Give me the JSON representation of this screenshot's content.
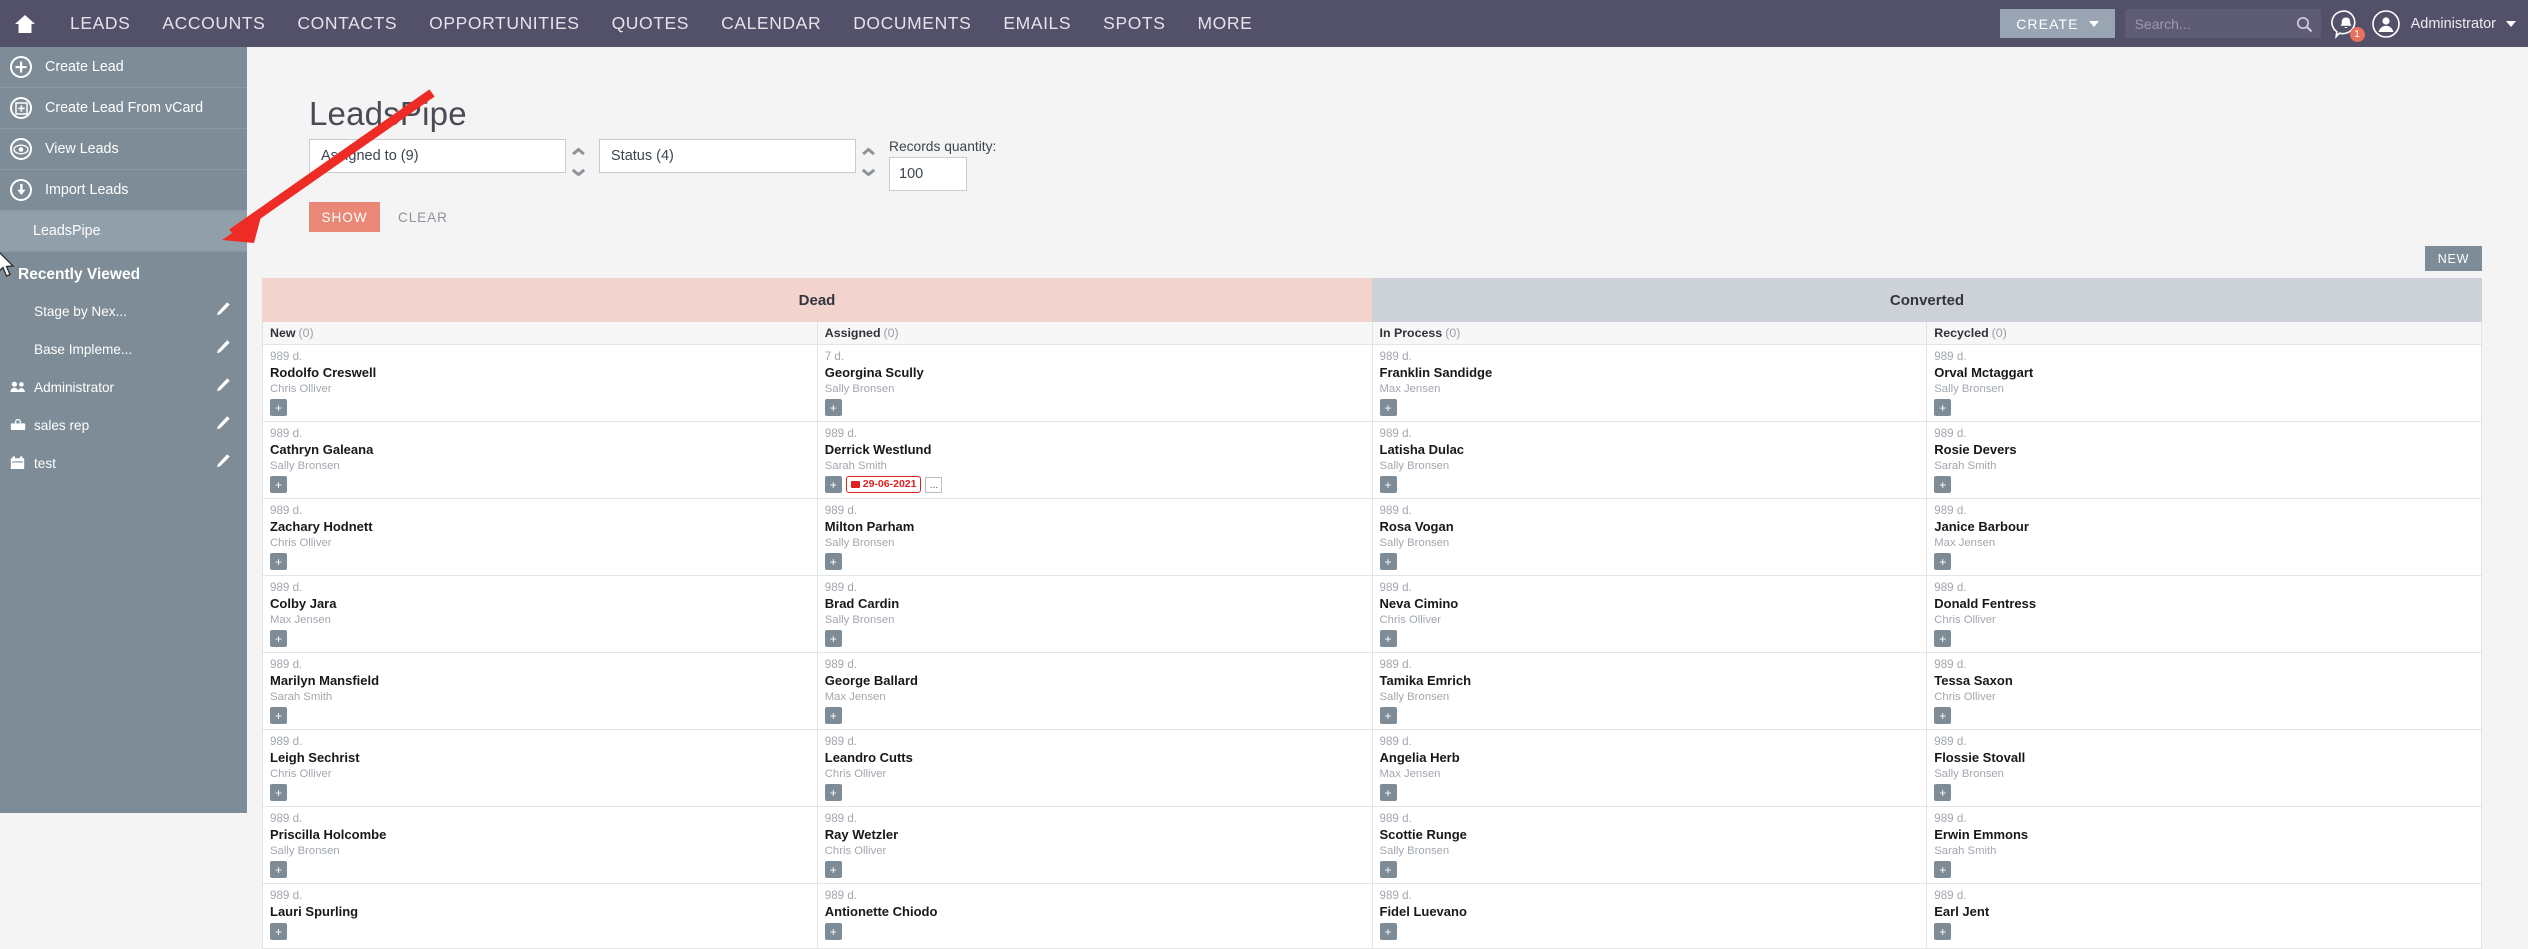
{
  "topnav": {
    "home_icon": "home-icon",
    "links": [
      "LEADS",
      "ACCOUNTS",
      "CONTACTS",
      "OPPORTUNITIES",
      "QUOTES",
      "CALENDAR",
      "DOCUMENTS",
      "EMAILS",
      "SPOTS",
      "MORE"
    ],
    "create_label": "CREATE",
    "search_placeholder": "Search...",
    "search_value": "",
    "notification_count": "1",
    "user_label": "Administrator",
    "bg_color": "#53506a"
  },
  "sidebar": {
    "items": [
      {
        "label": "Create Lead",
        "icon": "plus-circle-icon",
        "active": false
      },
      {
        "label": "Create Lead From vCard",
        "icon": "vcard-circle-icon",
        "active": false
      },
      {
        "label": "View Leads",
        "icon": "eye-circle-icon",
        "active": false
      },
      {
        "label": "Import Leads",
        "icon": "download-circle-icon",
        "active": false
      },
      {
        "label": "LeadsPipe",
        "icon": "",
        "active": true
      }
    ],
    "recent_title": "Recently Viewed",
    "recent_items": [
      {
        "label": "Stage by Nex...",
        "icon": ""
      },
      {
        "label": "Base Impleme...",
        "icon": ""
      },
      {
        "label": "Administrator",
        "icon": "users-icon"
      },
      {
        "label": "sales rep",
        "icon": "briefcase-icon"
      },
      {
        "label": "test",
        "icon": "calendar-icon"
      }
    ],
    "bg_color": "#7d8c96"
  },
  "main": {
    "page_title": "LeadsPipe",
    "filters": [
      {
        "name": "assigned-to",
        "value": "Assigned to (9)"
      },
      {
        "name": "status",
        "value": "Status (4)"
      }
    ],
    "records_quantity_label": "Records quantity:",
    "records_quantity_value": "100",
    "show_label": "SHOW",
    "clear_label": "CLEAR",
    "new_label": "NEW"
  },
  "board": {
    "groups": [
      {
        "label": "Dead",
        "color": "#f2d3cd"
      },
      {
        "label": "Converted",
        "color": "#cdd2d8"
      }
    ],
    "columns": [
      {
        "title": "New",
        "count": "(0)",
        "cards": [
          {
            "age": "989 d.",
            "name": "Rodolfo Creswell",
            "owner": "Chris Olliver"
          },
          {
            "age": "989 d.",
            "name": "Cathryn Galeana",
            "owner": "Sally Bronsen"
          },
          {
            "age": "989 d.",
            "name": "Zachary Hodnett",
            "owner": "Chris Olliver"
          },
          {
            "age": "989 d.",
            "name": "Colby Jara",
            "owner": "Max Jensen"
          },
          {
            "age": "989 d.",
            "name": "Marilyn Mansfield",
            "owner": "Sarah Smith"
          },
          {
            "age": "989 d.",
            "name": "Leigh Sechrist",
            "owner": "Chris Olliver"
          },
          {
            "age": "989 d.",
            "name": "Priscilla Holcombe",
            "owner": "Sally Bronsen"
          },
          {
            "age": "989 d.",
            "name": "Lauri Spurling",
            "owner": ""
          }
        ]
      },
      {
        "title": "Assigned",
        "count": "(0)",
        "cards": [
          {
            "age": "7 d.",
            "name": "Georgina Scully",
            "owner": "Sally Bronsen"
          },
          {
            "age": "989 d.",
            "name": "Derrick Westlund",
            "owner": "Sarah Smith",
            "date_badge": "29-06-2021",
            "has_more": true
          },
          {
            "age": "989 d.",
            "name": "Milton Parham",
            "owner": "Sally Bronsen"
          },
          {
            "age": "989 d.",
            "name": "Brad Cardin",
            "owner": "Sally Bronsen"
          },
          {
            "age": "989 d.",
            "name": "George Ballard",
            "owner": "Max Jensen"
          },
          {
            "age": "989 d.",
            "name": "Leandro Cutts",
            "owner": "Chris Olliver"
          },
          {
            "age": "989 d.",
            "name": "Ray Wetzler",
            "owner": "Chris Olliver"
          },
          {
            "age": "989 d.",
            "name": "Antionette Chiodo",
            "owner": ""
          }
        ]
      },
      {
        "title": "In Process",
        "count": "(0)",
        "cards": [
          {
            "age": "989 d.",
            "name": "Franklin Sandidge",
            "owner": "Max Jensen"
          },
          {
            "age": "989 d.",
            "name": "Latisha Dulac",
            "owner": "Sally Bronsen"
          },
          {
            "age": "989 d.",
            "name": "Rosa Vogan",
            "owner": "Sally Bronsen"
          },
          {
            "age": "989 d.",
            "name": "Neva Cimino",
            "owner": "Chris Olliver"
          },
          {
            "age": "989 d.",
            "name": "Tamika Emrich",
            "owner": "Sally Bronsen"
          },
          {
            "age": "989 d.",
            "name": "Angelia Herb",
            "owner": "Max Jensen"
          },
          {
            "age": "989 d.",
            "name": "Scottie Runge",
            "owner": "Sally Bronsen"
          },
          {
            "age": "989 d.",
            "name": "Fidel Luevano",
            "owner": ""
          }
        ]
      },
      {
        "title": "Recycled",
        "count": "(0)",
        "cards": [
          {
            "age": "989 d.",
            "name": "Orval Mctaggart",
            "owner": "Sally Bronsen"
          },
          {
            "age": "989 d.",
            "name": "Rosie Devers",
            "owner": "Sarah Smith"
          },
          {
            "age": "989 d.",
            "name": "Janice Barbour",
            "owner": "Max Jensen"
          },
          {
            "age": "989 d.",
            "name": "Donald Fentress",
            "owner": "Chris Olliver"
          },
          {
            "age": "989 d.",
            "name": "Tessa Saxon",
            "owner": "Chris Olliver"
          },
          {
            "age": "989 d.",
            "name": "Flossie Stovall",
            "owner": "Sally Bronsen"
          },
          {
            "age": "989 d.",
            "name": "Erwin Emmons",
            "owner": "Sarah Smith"
          },
          {
            "age": "989 d.",
            "name": "Earl Jent",
            "owner": ""
          }
        ]
      }
    ]
  }
}
